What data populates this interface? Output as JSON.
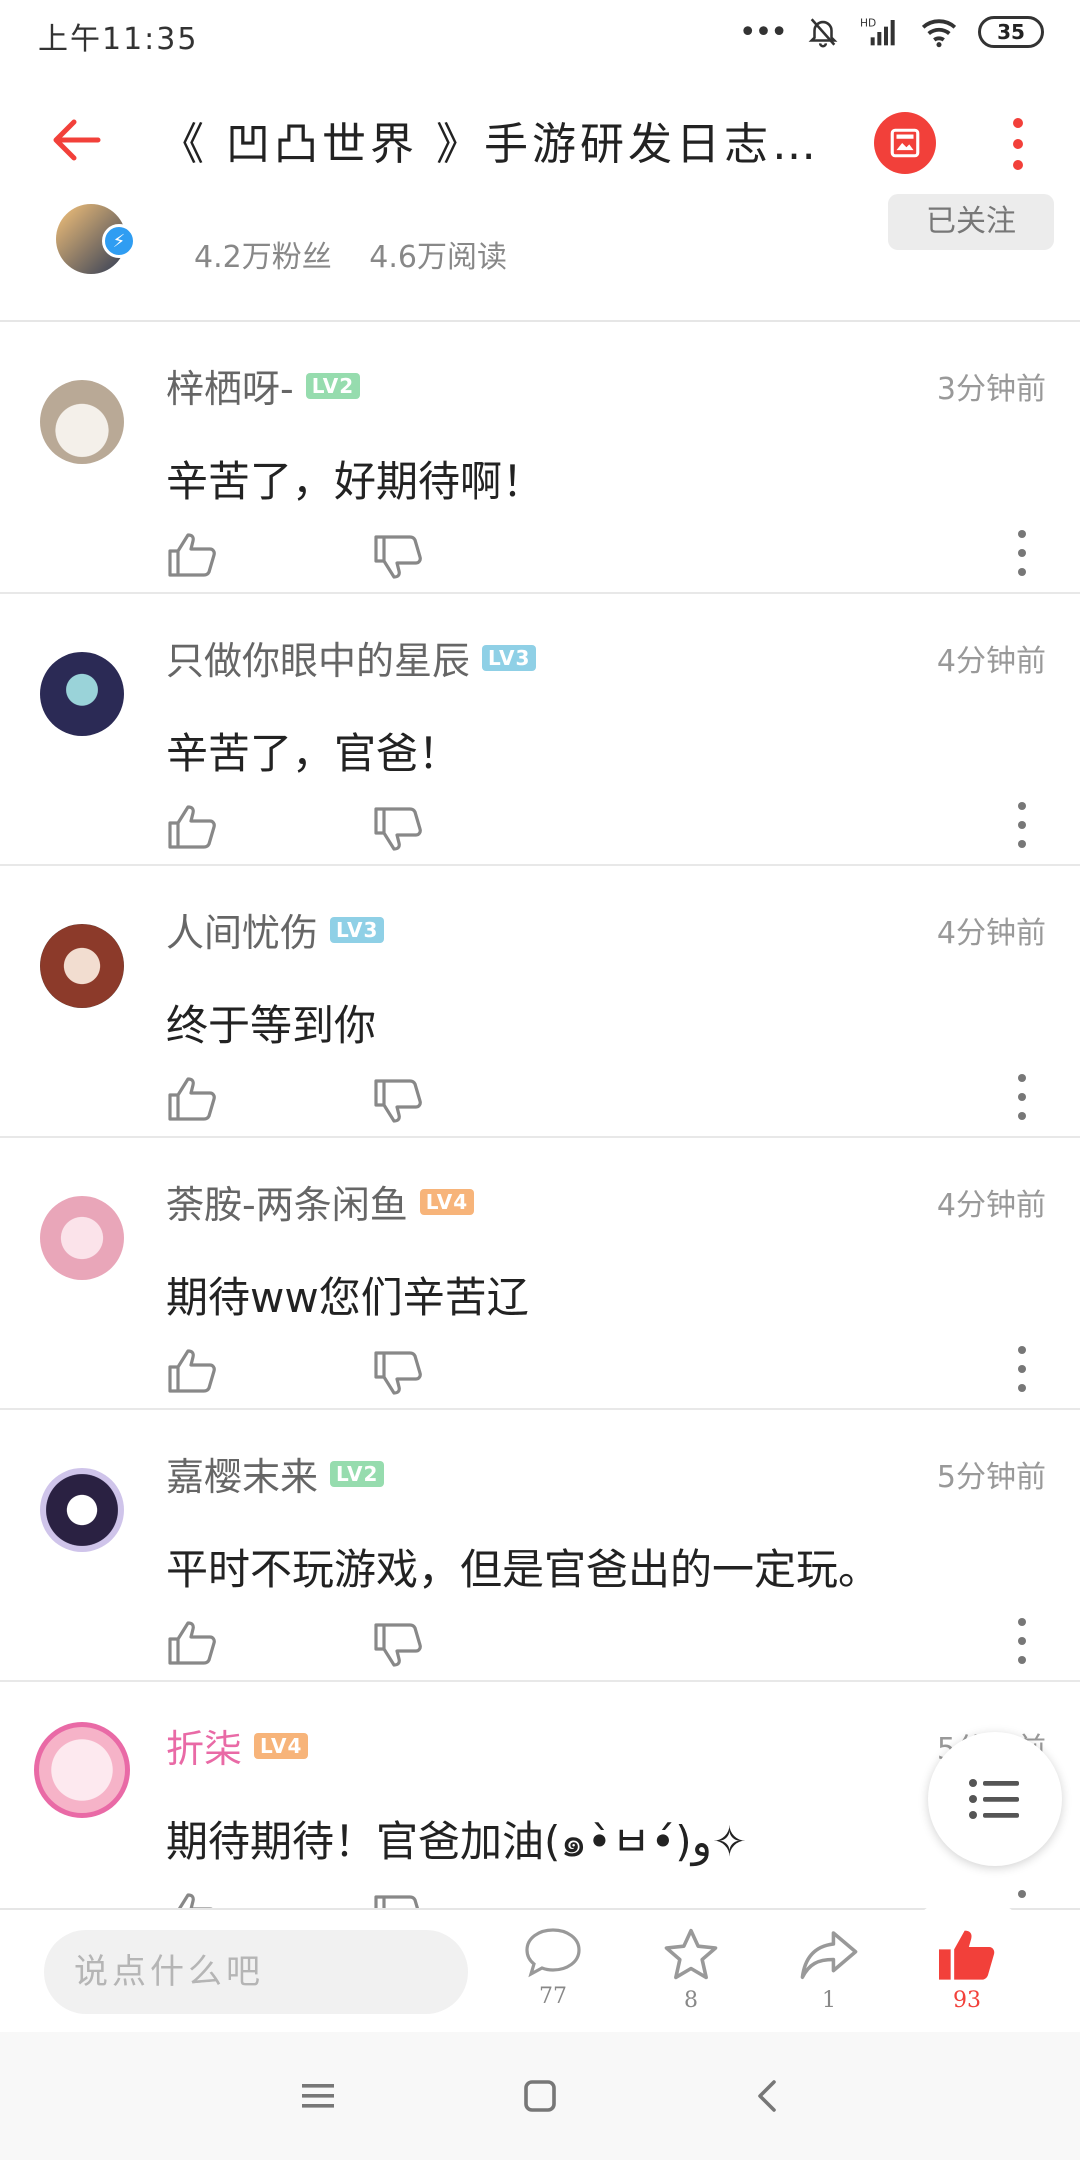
{
  "status_bar": {
    "time": "上午11:35",
    "dots": "•••",
    "battery": "35"
  },
  "header": {
    "title": "《 凹凸世界 》手游研发日志…"
  },
  "author": {
    "fans": "4.2万粉丝",
    "reads": "4.6万阅读",
    "follow_label": "已关注"
  },
  "comments": [
    {
      "user": "梓栖呀-",
      "level": "LV2",
      "time": "3分钟前",
      "text": "辛苦了，好期待啊！"
    },
    {
      "user": "只做你眼中的星辰",
      "level": "LV3",
      "time": "4分钟前",
      "text": "辛苦了，官爸！"
    },
    {
      "user": "人间忧伤",
      "level": "LV3",
      "time": "4分钟前",
      "text": "终于等到你"
    },
    {
      "user": "荼胺-两条闲鱼",
      "level": "LV4",
      "time": "4分钟前",
      "text": "期待ww您们辛苦辽"
    },
    {
      "user": "嘉樱末来",
      "level": "LV2",
      "time": "5分钟前",
      "text": "平时不玩游戏，但是官爸出的一定玩。"
    },
    {
      "user": "折柒",
      "level": "LV4",
      "time": "5分钟前",
      "text": "期待期待！官爸加油(๑•̀ㅂ•́)و✧"
    }
  ],
  "bottom_bar": {
    "input_placeholder": "说点什么吧",
    "comment_count": "77",
    "star_count": "8",
    "share_count": "1",
    "like_count": "93"
  },
  "colors": {
    "accent": "#f2403a",
    "lv2": "#96dcae",
    "lv3": "#8fd0e6",
    "lv4": "#f7b47a",
    "vip_name": "#e96aa6"
  }
}
